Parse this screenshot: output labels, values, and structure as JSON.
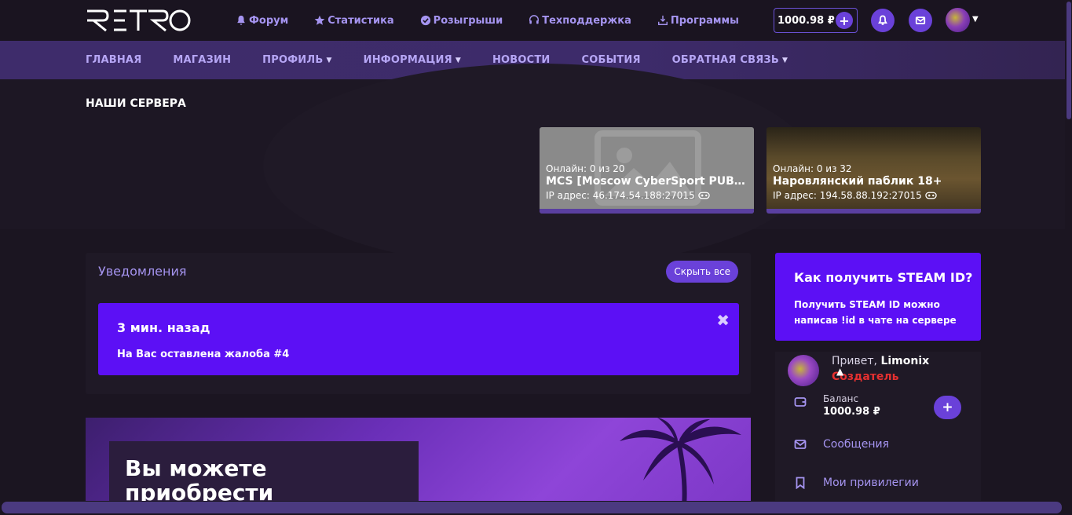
{
  "topbar": {
    "logo_text": "RETRO",
    "nav": [
      {
        "label": "Форум",
        "icon": "bell-icon"
      },
      {
        "label": "Статистика",
        "icon": "star-icon"
      },
      {
        "label": "Розыгрыши",
        "icon": "check-circle-icon"
      },
      {
        "label": "Техподдержка",
        "icon": "headset-icon"
      },
      {
        "label": "Программы",
        "icon": "download-icon"
      }
    ],
    "balance": "1000.98 ₽",
    "balance_add": "+"
  },
  "mainnav": {
    "items": [
      {
        "label": "ГЛАВНАЯ",
        "dropdown": false
      },
      {
        "label": "МАГАЗИН",
        "dropdown": false
      },
      {
        "label": "ПРОФИЛЬ",
        "dropdown": true
      },
      {
        "label": "ИНФОРМАЦИЯ",
        "dropdown": true
      },
      {
        "label": "НОВОСТИ",
        "dropdown": false
      },
      {
        "label": "СОБЫТИЯ",
        "dropdown": false
      },
      {
        "label": "ОБРАТНАЯ СВЯЗЬ",
        "dropdown": true
      }
    ]
  },
  "servers": {
    "title": "НАШИ СЕРВЕРА",
    "cards": [
      {
        "online": "Онлайн: 0 из 20",
        "name": "MCS [Moscow CyberSport PUBLIC...",
        "ip": "IP адрес: 46.174.54.188:27015"
      },
      {
        "online": "Онлайн: 0 из 32",
        "name": "Наровлянский паблик 18+",
        "ip": "IP адрес: 194.58.88.192:27015"
      }
    ]
  },
  "notifications": {
    "title": "Уведомления",
    "hide_all": "Скрыть все",
    "items": [
      {
        "time": "3 мин. назад",
        "text": "На Вас оставлена жалоба #4"
      }
    ]
  },
  "promo": {
    "text": "Вы можете приобрести привилегию тут:"
  },
  "steam": {
    "title": "Как получить STEAM ID?",
    "text": "Получить STEAM ID можно написав !id в чате на сервере"
  },
  "profile": {
    "hello_prefix": "Привет, ",
    "username": "Limonix",
    "role": "Создатель",
    "balance_label": "Баланс",
    "balance_value": "1000.98 ₽",
    "balance_add": "+",
    "messages_label": "Сообщения",
    "privileges_label": "Мои привилегии"
  },
  "colors": {
    "accent": "#6a41d9",
    "card_purple": "#5c10f5",
    "nav_text": "#a594f0",
    "role_red": "#e53030"
  }
}
